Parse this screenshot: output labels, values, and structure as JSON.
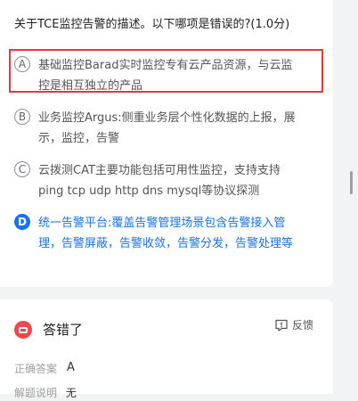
{
  "question": {
    "text": "关于TCE监控告警的描述。以下哪项是错误的?(1.0分)"
  },
  "options": [
    {
      "letter": "A",
      "line1": "基础监控Barad实时监控专有云产品资源，与云监",
      "line2": "控是相互独立的产品",
      "selected": false,
      "highlighted": true
    },
    {
      "letter": "B",
      "line1": "业务监控Argus:侧重业务层个性化数据的上报，展",
      "line2": "示，监控，告警",
      "selected": false,
      "highlighted": false
    },
    {
      "letter": "C",
      "line1": "云拨测CAT主要功能包括可用性监控，支持支持",
      "line2": "ping tcp udp http dns mysql等协议探测",
      "selected": false,
      "highlighted": false
    },
    {
      "letter": "D",
      "line1": "统一告警平台:覆盖告警管理场景包含告警接入管",
      "line2": "理，告警屏蔽，告警收敛，告警分发，告警处理等",
      "selected": true,
      "highlighted": false
    }
  ],
  "result": {
    "title": "答错了",
    "feedback_label": "反馈",
    "correct_answer_label": "正确答案",
    "correct_answer_value": "A",
    "explanation_label": "解题说明",
    "explanation_value": "无"
  },
  "colors": {
    "accent": "#1a73e8",
    "error": "#f04848",
    "highlight_box": "#e23a3a"
  }
}
